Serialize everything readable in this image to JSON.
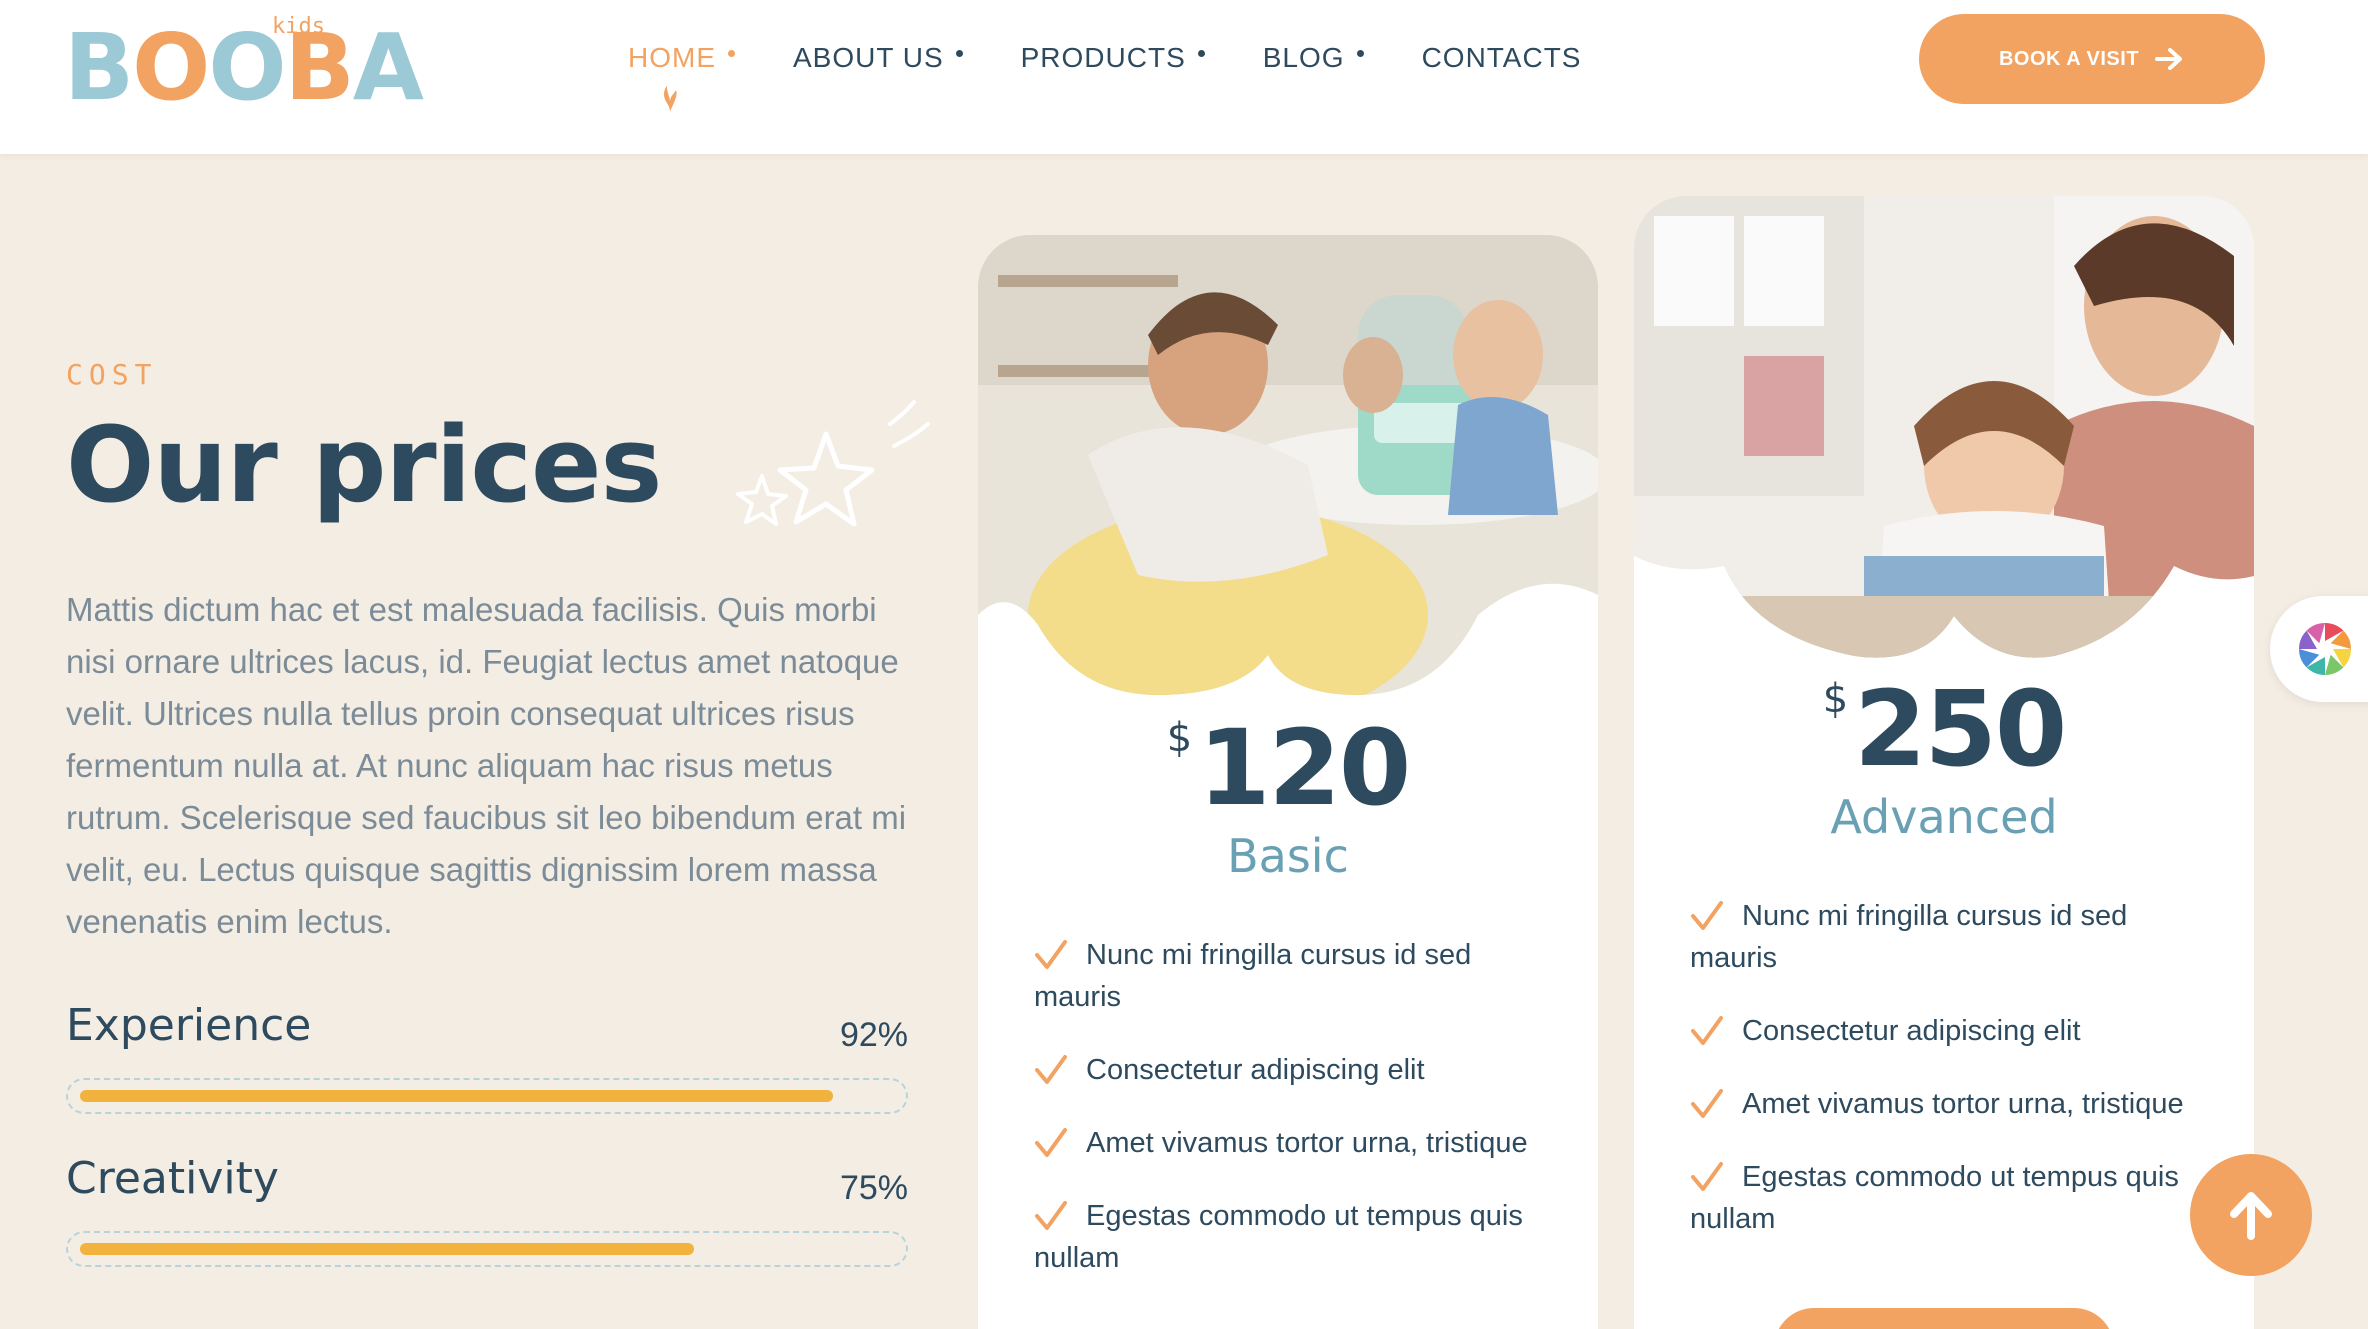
{
  "header": {
    "logo": {
      "kids": "kids",
      "word": [
        "B",
        "O",
        "O",
        "B",
        "A"
      ]
    },
    "nav": [
      {
        "label": "HOME",
        "active": true
      },
      {
        "label": "ABOUT US",
        "active": false
      },
      {
        "label": "PRODUCTS",
        "active": false
      },
      {
        "label": "BLOG",
        "active": false
      },
      {
        "label": "CONTACTS",
        "active": false
      }
    ],
    "cta_label": "BOOK A VISIT",
    "cta_icon": "arrow-right-icon"
  },
  "section": {
    "eyebrow": "COST",
    "title": "Our prices",
    "description": "Mattis dictum hac et est malesuada facilisis. Quis morbi nisi ornare ultrices lacus, id. Feugiat lectus amet natoque velit. Ultrices nulla tellus proin consequat ultrices risus fermentum nulla at. At nunc aliquam hac risus metus rutrum. Scelerisque sed faucibus sit leo bibendum erat mi velit, eu. Lectus quisque sagittis dignissim lorem massa venenatis enim lectus."
  },
  "skills": [
    {
      "name": "Experience",
      "percent_label": "92%",
      "value": 0.92
    },
    {
      "name": "Creativity",
      "percent_label": "75%",
      "value": 0.75
    }
  ],
  "plans": [
    {
      "currency": "$",
      "price": "120",
      "name": "Basic",
      "features": [
        "Nunc mi fringilla cursus id sed mauris",
        "Consectetur adipiscing elit",
        "Amet vivamus tortor urna, tristique",
        "Egestas commodo ut tempus quis nullam"
      ]
    },
    {
      "currency": "$",
      "price": "250",
      "name": "Advanced",
      "features": [
        "Nunc mi fringilla cursus id sed mauris",
        "Consectetur adipiscing elit",
        "Amet vivamus tortor urna, tristique",
        "Egestas commodo ut tempus quis nullam"
      ]
    }
  ],
  "floating": {
    "color_picker_icon": "color-wheel-icon",
    "scroll_top_icon": "arrow-up-icon"
  },
  "colors": {
    "accent": "#f2a261",
    "navy": "#2e4a5e",
    "teal": "#6aa0b3",
    "background": "#f4ede3",
    "progress": "#f2b23e"
  }
}
